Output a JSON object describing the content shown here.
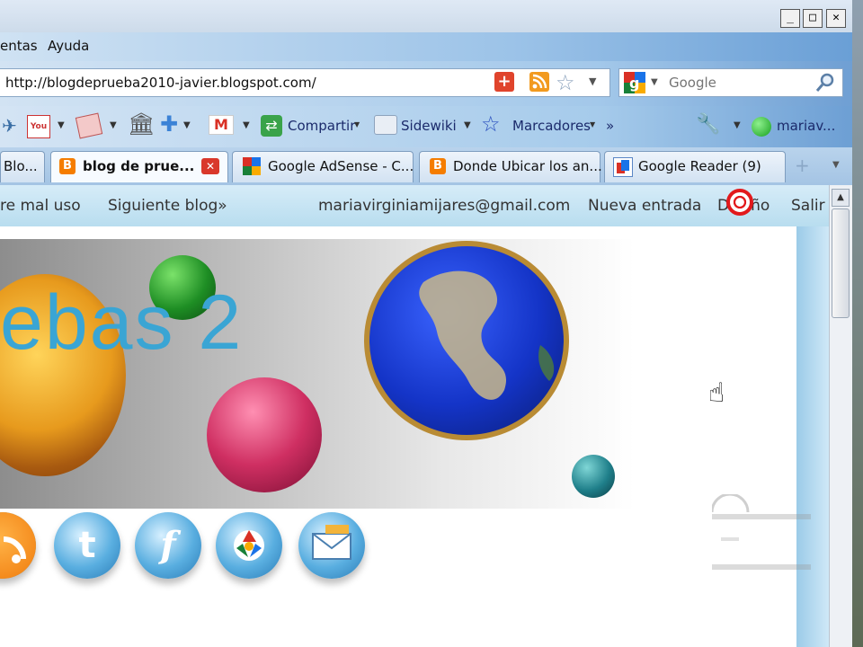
{
  "menu": {
    "items": [
      "entas",
      "Ayuda"
    ]
  },
  "window_controls": {
    "minimize": "_",
    "maximize": "□",
    "close": "✕"
  },
  "address_bar": {
    "url": "http://blogdeprueba2010-javier.blogspot.com/"
  },
  "search": {
    "placeholder": "Google"
  },
  "bookmarks": {
    "compartir": "Compartir",
    "sidewiki": "Sidewiki",
    "marcadores": "Marcadores",
    "overflow": "»",
    "user": "mariav..."
  },
  "tabs": [
    {
      "label": "Blo..."
    },
    {
      "label": "blog de prue..."
    },
    {
      "label": "Google AdSense - C..."
    },
    {
      "label": "Donde Ubicar los an..."
    },
    {
      "label": "Google Reader (9)"
    }
  ],
  "blogger_nav": {
    "report": "re mal uso",
    "next_blog": "Siguiente blog»",
    "email": "mariavirginiamijares@gmail.com",
    "new_post": "Nueva entrada",
    "design": "Diseño",
    "logout": "Salir"
  },
  "blog": {
    "title_fragment": "ebas 2"
  },
  "colors": {
    "blog_title": "#3aa5d4",
    "blogger_orange": "#f57d00"
  }
}
